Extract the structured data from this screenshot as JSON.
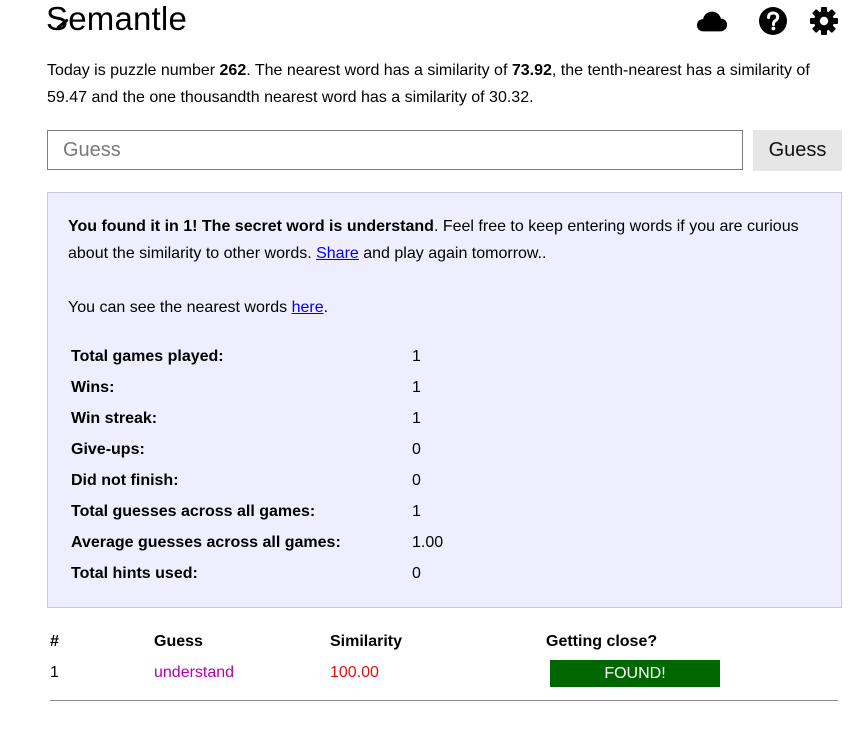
{
  "app": {
    "logo": "Semantle"
  },
  "header": {
    "icons": [
      "cloud-icon",
      "help-icon",
      "gear-icon"
    ]
  },
  "intro": {
    "prefix": "Today is puzzle number ",
    "puzzle_number": "262",
    "mid1": ". The nearest word has a similarity of ",
    "nearest_similarity": "73.92",
    "mid2": ", the tenth-nearest has a similarity of 59.47 and the one thousandth nearest word has a similarity of 30.32."
  },
  "guess_form": {
    "value": "",
    "placeholder": "Guess",
    "button_label": "Guess"
  },
  "result": {
    "found_bold": "You found it in 1! The secret word is understand",
    "found_rest": ". Feel free to keep entering words if you are curious about the similarity to other words. ",
    "share_link": "Share",
    "found_tail": " and play again tomorrow..",
    "nearest_prefix": "You can see the nearest words ",
    "nearest_link": "here",
    "nearest_suffix": "."
  },
  "stats": [
    {
      "label": "Total games played:",
      "value": "1"
    },
    {
      "label": "Wins:",
      "value": "1"
    },
    {
      "label": "Win streak:",
      "value": "1"
    },
    {
      "label": "Give-ups:",
      "value": "0"
    },
    {
      "label": "Did not finish:",
      "value": "0"
    },
    {
      "label": "Total guesses across all games:",
      "value": "1"
    },
    {
      "label": "Average guesses across all games:",
      "value": "1.00"
    },
    {
      "label": "Total hints used:",
      "value": "0"
    }
  ],
  "guess_table": {
    "headers": {
      "num": "#",
      "guess": "Guess",
      "similarity": "Similarity",
      "close": "Getting close?"
    },
    "rows": [
      {
        "num": "1",
        "guess": "understand",
        "similarity": "100.00",
        "close": "FOUND!"
      }
    ]
  },
  "colors": {
    "panel_bg": "#eeeeff",
    "found_bar": "#006600",
    "guess_word": "#b000b0",
    "similarity_value": "#dd1111",
    "link": "#0000ee"
  }
}
